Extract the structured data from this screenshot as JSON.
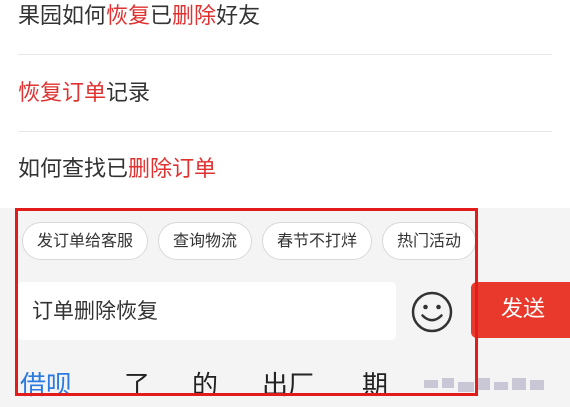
{
  "suggestions": [
    {
      "parts": [
        {
          "text": "果园如何",
          "hl": false
        },
        {
          "text": "恢复",
          "hl": true
        },
        {
          "text": "已",
          "hl": false
        },
        {
          "text": "删除",
          "hl": true
        },
        {
          "text": "好友",
          "hl": false
        }
      ]
    },
    {
      "parts": [
        {
          "text": "恢复",
          "hl": true
        },
        {
          "text": "订单",
          "hl": true
        },
        {
          "text": "记录",
          "hl": false
        }
      ]
    },
    {
      "parts": [
        {
          "text": "如何查找已",
          "hl": false
        },
        {
          "text": "删除",
          "hl": true
        },
        {
          "text": "订单",
          "hl": true
        }
      ]
    }
  ],
  "chips": [
    "发订单给客服",
    "查询物流",
    "春节不打烊",
    "热门活动"
  ],
  "input": {
    "value": "订单删除恢复"
  },
  "send": {
    "label": "发送"
  },
  "emoji": {
    "icon": "smiley-icon"
  },
  "candidates": [
    "借呗",
    "了",
    "的",
    "出厂",
    "期"
  ],
  "colors": {
    "highlight": "#e03131",
    "send": "#e8392c",
    "annotation": "#e21b1b",
    "candidate_first": "#2a7ae2"
  }
}
